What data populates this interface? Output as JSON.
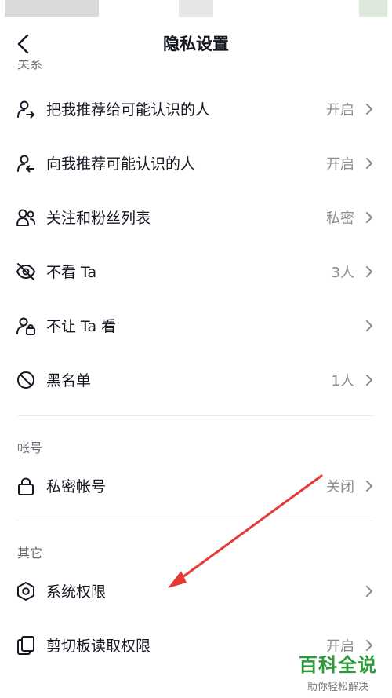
{
  "nav": {
    "title": "隐私设置"
  },
  "sections": {
    "relations": "关系",
    "account": "帐号",
    "other": "其它"
  },
  "rows": [
    {
      "icon": "recommend-me-icon",
      "label": "把我推荐给可能认识的人",
      "value": "开启"
    },
    {
      "icon": "recommend-to-me-icon",
      "label": "向我推荐可能认识的人",
      "value": "开启"
    },
    {
      "icon": "follow-list-icon",
      "label": "关注和粉丝列表",
      "value": "私密"
    },
    {
      "icon": "eye-off-icon",
      "label": "不看 Ta",
      "value": "3人"
    },
    {
      "icon": "user-lock-icon",
      "label": "不让 Ta 看",
      "value": ""
    },
    {
      "icon": "block-icon",
      "label": "黑名单",
      "value": "1人"
    },
    {
      "icon": "lock-icon",
      "label": "私密帐号",
      "value": "关闭"
    },
    {
      "icon": "hexagon-settings-icon",
      "label": "系统权限",
      "value": ""
    },
    {
      "icon": "clipboard-icon",
      "label": "剪切板读取权限",
      "value": "开启"
    }
  ],
  "annotation": {
    "color": "#e53935"
  },
  "watermark": {
    "title": "百科全说",
    "subtitle": "助你轻松解决"
  }
}
